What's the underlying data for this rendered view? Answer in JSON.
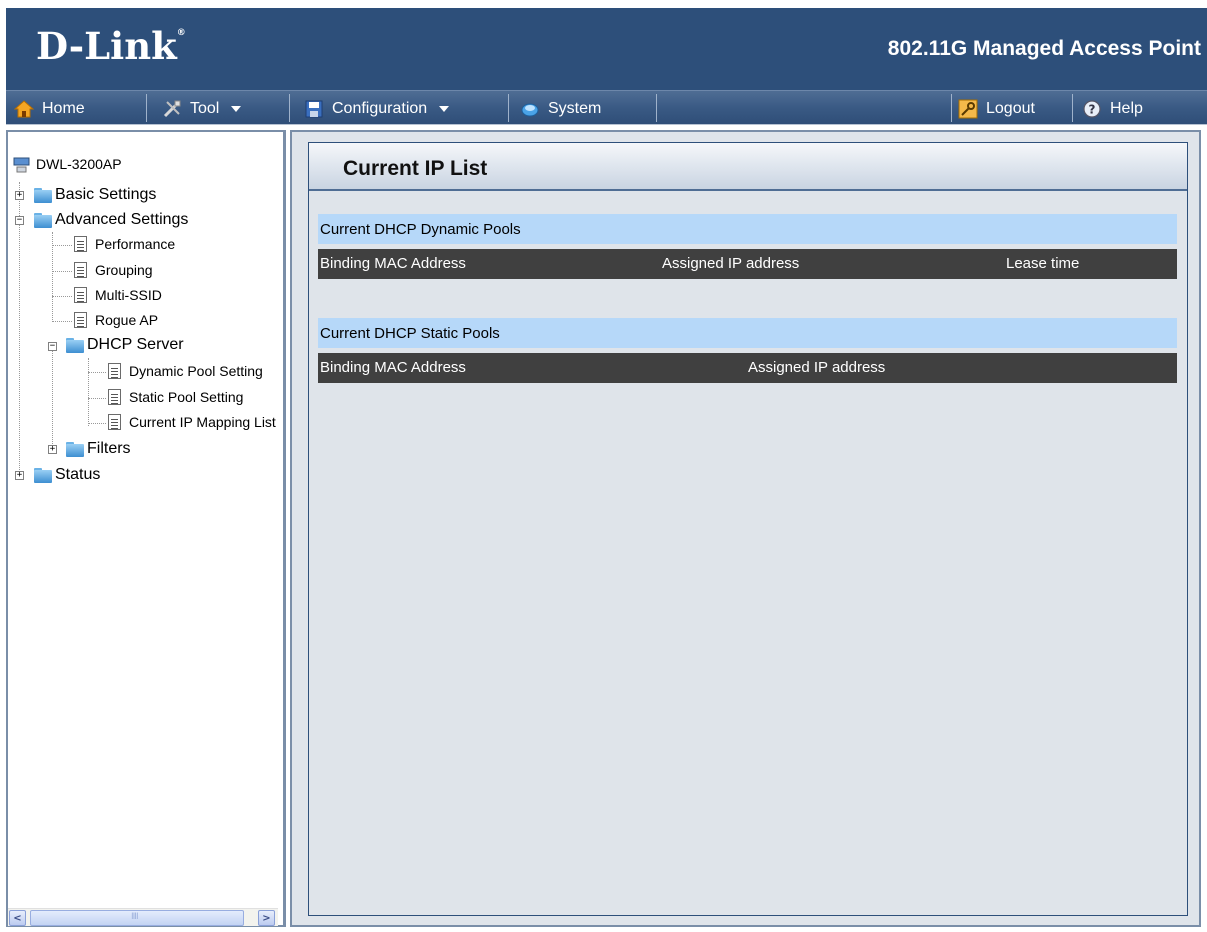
{
  "brand": {
    "logo": "D-Link",
    "product": "802.11G Managed Access Point"
  },
  "menu": {
    "home": "Home",
    "tool": "Tool",
    "configuration": "Configuration",
    "system": "System",
    "logout": "Logout",
    "help": "Help"
  },
  "tree": {
    "root": "DWL-3200AP",
    "basic": "Basic Settings",
    "advanced": "Advanced Settings",
    "performance": "Performance",
    "grouping": "Grouping",
    "multissid": "Multi-SSID",
    "rogue": "Rogue AP",
    "dhcp": "DHCP Server",
    "dynamic": "Dynamic Pool Setting",
    "static": "Static Pool Setting",
    "current": "Current IP Mapping List",
    "filters": "Filters",
    "status": "Status"
  },
  "page": {
    "title": "Current IP List",
    "dynamic_section": "Current DHCP Dynamic Pools",
    "dynamic_columns": [
      "Binding MAC Address",
      "Assigned IP address",
      "Lease time"
    ],
    "static_section": "Current DHCP Static Pools",
    "static_columns": [
      "Binding MAC Address",
      "Assigned IP address"
    ]
  },
  "colors": {
    "header_bg": "#2d4f7a",
    "section_bg": "#b6d8f9",
    "column_header_bg": "#404040",
    "content_bg": "#dfe4ea"
  }
}
